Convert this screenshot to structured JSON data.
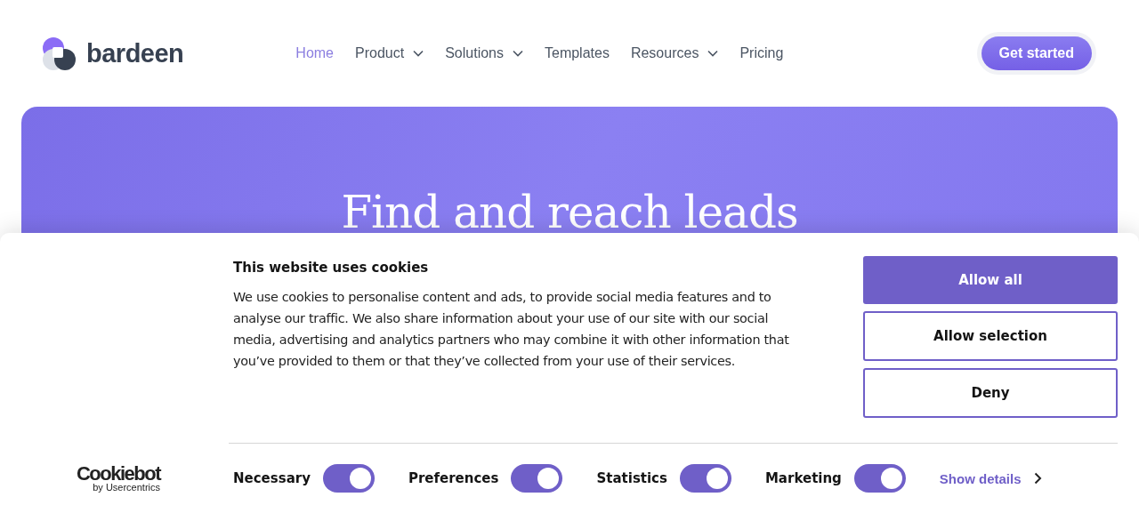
{
  "header": {
    "logo": "bardeen",
    "nav": [
      {
        "label": "Home",
        "selected": true,
        "dropdown": false
      },
      {
        "label": "Product",
        "selected": false,
        "dropdown": true
      },
      {
        "label": "Solutions",
        "selected": false,
        "dropdown": true
      },
      {
        "label": "Templates",
        "selected": false,
        "dropdown": false
      },
      {
        "label": "Resources",
        "selected": false,
        "dropdown": true
      },
      {
        "label": "Pricing",
        "selected": false,
        "dropdown": false
      }
    ],
    "cta": "Get started"
  },
  "hero": {
    "heading": "Find and reach leads"
  },
  "cookie_banner": {
    "brand": "Cookiebot",
    "brand_sub": "by Usercentrics",
    "title": "This website uses cookies",
    "body": "We use cookies to personalise content and ads, to provide social media features and to analyse our traffic. We also share information about your use of our site with our social media, advertising and analytics partners who may combine it with other information that you’ve provided to them or that they’ve collected from your use of their services.",
    "buttons": [
      {
        "label": "Allow all",
        "kind": "primary"
      },
      {
        "label": "Allow selection",
        "kind": "outline"
      },
      {
        "label": "Deny",
        "kind": "outline"
      }
    ],
    "toggles": [
      {
        "label": "Necessary",
        "on": true
      },
      {
        "label": "Preferences",
        "on": true
      },
      {
        "label": "Statistics",
        "on": true
      },
      {
        "label": "Marketing",
        "on": true
      }
    ],
    "details_link": "Show details"
  }
}
